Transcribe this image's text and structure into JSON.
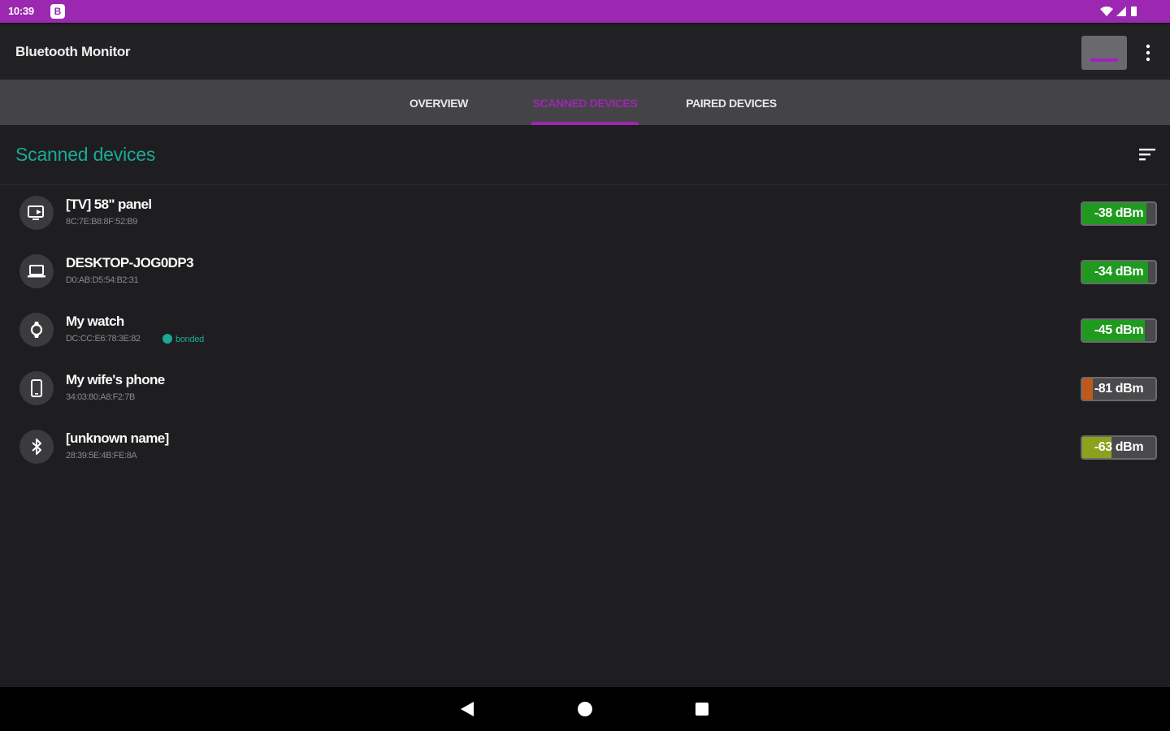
{
  "status_bar": {
    "time": "10:39",
    "notification_icon": "app-notification-icon",
    "system_icons": [
      "wifi-icon",
      "cell-signal-icon",
      "battery-icon"
    ],
    "color": "#9c27b0"
  },
  "app_bar": {
    "title": "Bluetooth Monitor",
    "actions": [
      "scan-toggle-button",
      "more-options-icon"
    ]
  },
  "tabs": [
    {
      "label": "OVERVIEW",
      "active": false
    },
    {
      "label": "SCANNED DEVICES",
      "active": true
    },
    {
      "label": "PAIRED DEVICES",
      "active": false
    }
  ],
  "section": {
    "heading": "Scanned devices",
    "sort_icon": "sort-icon"
  },
  "devices": [
    {
      "name": "[TV] 58\" panel",
      "mac": "8C:7E:B8:8F:52:B9",
      "icon": "tv-cast-icon",
      "bonded": false,
      "rssi": "-38 dBm",
      "signal": 0.88,
      "signal_color": "#1f9a1f"
    },
    {
      "name": "DESKTOP-JOG0DP3",
      "mac": "D0:AB:D5:54:B2:31",
      "icon": "laptop-icon",
      "bonded": false,
      "rssi": "-34 dBm",
      "signal": 0.9,
      "signal_color": "#1f9a1f"
    },
    {
      "name": "My watch",
      "mac": "DC:CC:E6:78:3E:82",
      "icon": "watch-icon",
      "bonded": true,
      "bonded_label": "bonded",
      "rssi": "-45 dBm",
      "signal": 0.85,
      "signal_color": "#1f9a1f"
    },
    {
      "name": "My wife's phone",
      "mac": "34:03:80:A8:F2:7B",
      "icon": "smartphone-icon",
      "bonded": false,
      "rssi": "-81 dBm",
      "signal": 0.14,
      "signal_color": "#c0581a"
    },
    {
      "name": "[unknown name]",
      "mac": "28:39:5E:4B:FE:8A",
      "icon": "bluetooth-icon",
      "bonded": false,
      "rssi": "-63 dBm",
      "signal": 0.4,
      "signal_color": "#8aa21c"
    }
  ],
  "nav_bar": [
    "back-icon",
    "home-icon",
    "recents-icon"
  ]
}
